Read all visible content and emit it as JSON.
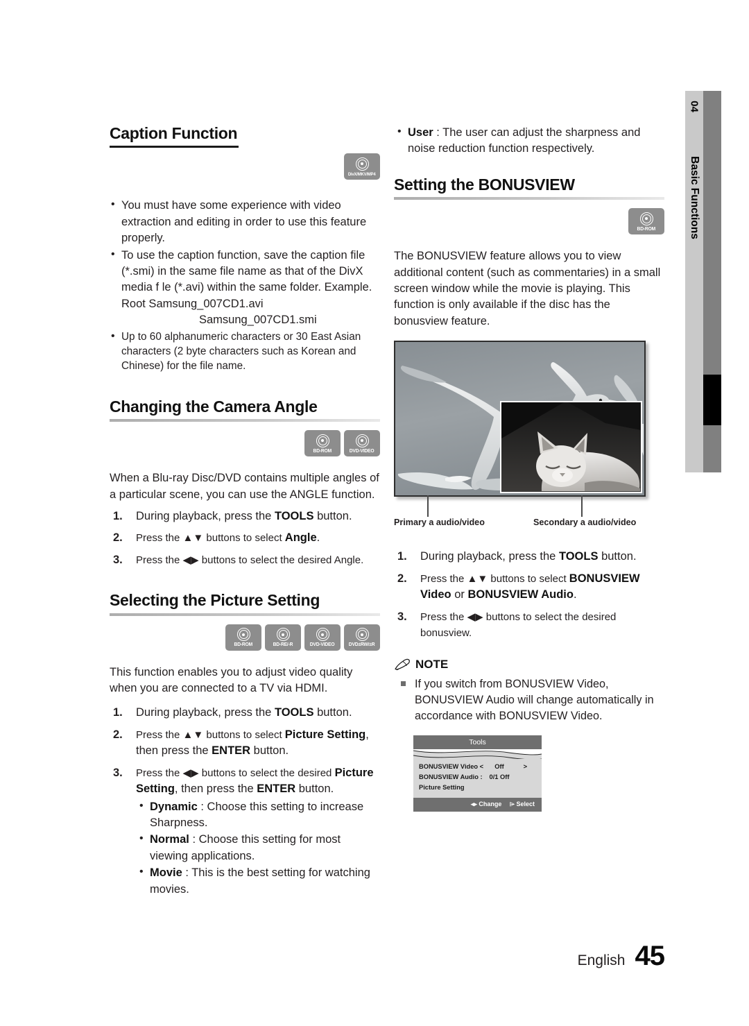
{
  "page": {
    "chapter_number": "04",
    "chapter_label": "Basic Functions",
    "footer_language": "English",
    "footer_page_number": "45"
  },
  "left_column": {
    "caption_function": {
      "title": "Caption Function",
      "badges": [
        {
          "name": "divx-mkv-mp4-badge",
          "label": "DivX/MKV/MP4"
        }
      ],
      "bullets": [
        "You must have some experience with video extraction and editing in order to use this feature properly.",
        "To use the caption function, save the caption file (*.smi) in the same file name as that of the DivX media f le (*.avi) within the same folder.",
        "Up to 60 alphanumeric characters or 30 East Asian characters (2 byte characters such as Korean and Chinese) for the file name."
      ],
      "example_line_1": "Example. Root Samsung_007CD1.avi",
      "example_line_2": "Samsung_007CD1.smi"
    },
    "camera_angle": {
      "title": "Changing the Camera Angle",
      "badges": [
        {
          "name": "bd-rom-badge",
          "label": "BD-ROM"
        },
        {
          "name": "dvd-video-badge",
          "label": "DVD-VIDEO"
        }
      ],
      "intro": "When a Blu-ray Disc/DVD contains multiple angles of a particular scene, you can use the ANGLE function.",
      "steps": [
        {
          "num": "1.",
          "pre": "During playback, press the ",
          "bold": "TOOLS",
          "post": " button."
        },
        {
          "num": "2.",
          "pre": "Press the ▲▼ buttons to select ",
          "bold": "Angle",
          "post": "."
        },
        {
          "num": "3.",
          "pre": "Press the ◀▶ buttons to select the desired Angle.",
          "bold": "",
          "post": ""
        }
      ]
    },
    "picture_setting": {
      "title": "Selecting the Picture Setting",
      "badges": [
        {
          "name": "bd-rom-badge",
          "label": "BD-ROM"
        },
        {
          "name": "bd-re-r-badge",
          "label": "BD-RE/-R"
        },
        {
          "name": "dvd-video-badge",
          "label": "DVD-VIDEO"
        },
        {
          "name": "dvd-rw-r-badge",
          "label": "DVD±RW/±R"
        }
      ],
      "intro": "This function enables you to adjust video quality when you are connected to a TV via HDMI.",
      "step1_pre": "During playback, press the ",
      "step1_bold": "TOOLS",
      "step1_post": " button.",
      "step2_pre": "Press the ▲▼ buttons to select ",
      "step2_bold1": "Picture Setting",
      "step2_mid": ", then press the ",
      "step2_bold2": "ENTER",
      "step2_post": " button.",
      "step3_pre": "Press the ◀▶ buttons to select the desired ",
      "step3_bold1": "Picture Setting",
      "step3_mid": ", then press the ",
      "step3_bold2": "ENTER",
      "step3_post": " button.",
      "options": [
        {
          "name": "Dynamic",
          "desc": " : Choose this setting to increase Sharpness."
        },
        {
          "name": "Normal",
          "desc": " : Choose this setting for most viewing applications."
        },
        {
          "name": "Movie",
          "desc": " : This is the best setting for watching movies."
        }
      ]
    }
  },
  "right_column": {
    "user_option": {
      "name": "User",
      "desc": " : The user can adjust the sharpness and noise reduction function respectively."
    },
    "bonusview": {
      "title": "Setting the BONUSVIEW",
      "badges": [
        {
          "name": "bd-rom-badge",
          "label": "BD-ROM"
        }
      ],
      "intro": "The BONUSVIEW feature allows you to view additional content (such as commentaries) in a small screen window while the movie is playing. This function is only available if the disc has the bonusview feature.",
      "photo": {
        "caption_primary": "Primary a audio/video",
        "caption_secondary": "Secondary a audio/video",
        "main_subject": "seagulls flying in grayscale sky",
        "pip_subject": "sleeping cat"
      },
      "steps": [
        {
          "num": "1.",
          "pre": "During playback, press the ",
          "bold": "TOOLS",
          "post": " button."
        },
        {
          "num": "2.",
          "pre": "Press the ▲▼ buttons to select ",
          "bold": "BONUSVIEW Video",
          "mid": " or ",
          "bold2": "BONUSVIEW Audio",
          "post": "."
        },
        {
          "num": "3.",
          "pre": "Press the ◀▶ buttons to select the desired bonusview.",
          "bold": "",
          "post": ""
        }
      ]
    },
    "note": {
      "heading": "NOTE",
      "items": [
        "If you switch from BONUSVIEW Video, BONUSVIEW Audio will change automatically in accordance with BONUSVIEW Video."
      ]
    },
    "osd": {
      "title": "Tools",
      "rows": [
        {
          "label": "BONUSVIEW Video <",
          "value": "Off",
          "arrow": ">"
        },
        {
          "label": "BONUSVIEW Audio :",
          "value": "0/1 Off",
          "arrow": ""
        },
        {
          "label": "Picture Setting",
          "value": "",
          "arrow": ""
        }
      ],
      "footer_change": "◂▸ Change",
      "footer_select": "⌲ Select"
    }
  }
}
